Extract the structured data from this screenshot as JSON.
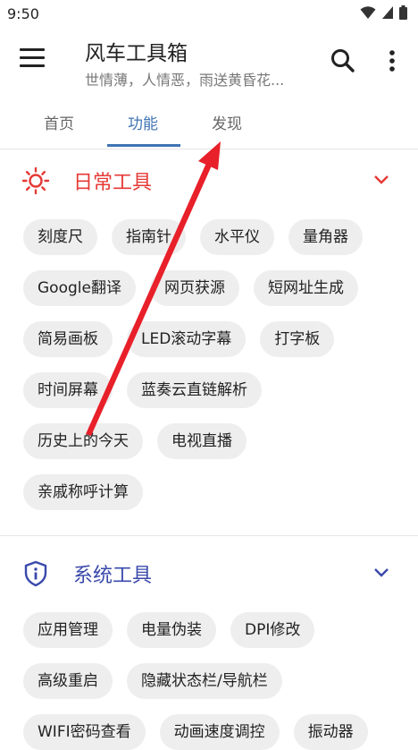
{
  "status_bar": {
    "time": "9:50"
  },
  "app_bar": {
    "title": "风车工具箱",
    "subtitle": "世情薄，人情恶，雨送黄昏花...",
    "menu_icon": "hamburger-menu-icon",
    "search_icon": "search-icon",
    "more_icon": "more-vertical-icon"
  },
  "tabs": [
    {
      "label": "首页",
      "active": false
    },
    {
      "label": "功能",
      "active": true
    },
    {
      "label": "发现",
      "active": false
    }
  ],
  "sections": [
    {
      "title": "日常工具",
      "color": "#e53935",
      "icon": "sun-icon",
      "expanded": true,
      "rows": [
        [
          "刻度尺",
          "指南针",
          "水平仪",
          "量角器"
        ],
        [
          "Google翻译",
          "网页获源",
          "短网址生成"
        ],
        [
          "简易画板",
          "LED滚动字幕",
          "打字板"
        ],
        [
          "时间屏幕",
          "蓝奏云直链解析"
        ],
        [
          "历史上的今天",
          "电视直播"
        ],
        [
          "亲戚称呼计算"
        ]
      ]
    },
    {
      "title": "系统工具",
      "color": "#3949ab",
      "icon": "shield-info-icon",
      "expanded": true,
      "rows": [
        [
          "应用管理",
          "电量伪装",
          "DPI修改"
        ],
        [
          "高级重启",
          "隐藏状态栏/导航栏"
        ],
        [
          "WIFI密码查看",
          "动画速度调控",
          "振动器"
        ]
      ]
    }
  ],
  "colors": {
    "accent": "#3f73b3",
    "chip_bg": "#eeeeee",
    "annotation_arrow": "#e8202a"
  }
}
